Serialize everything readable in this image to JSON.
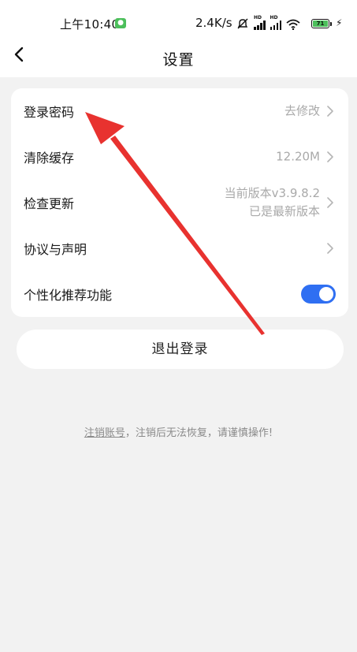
{
  "status_bar": {
    "time": "上午10:40",
    "speed": "2.4K/s",
    "battery": "71"
  },
  "header": {
    "title": "设置",
    "back_icon": "chevron-left-icon"
  },
  "settings": [
    {
      "label": "登录密码",
      "value": "去修改",
      "control": "chevron"
    },
    {
      "label": "清除缓存",
      "value": "12.20M",
      "control": "chevron"
    },
    {
      "label": "检查更新",
      "value_line1": "当前版本v3.9.8.2",
      "value_line2": "已是最新版本",
      "control": "chevron"
    },
    {
      "label": "协议与声明",
      "value": "",
      "control": "chevron"
    },
    {
      "label": "个性化推荐功能",
      "control": "toggle",
      "toggle_on": true
    }
  ],
  "logout_label": "退出登录",
  "cancel_account": {
    "link": "注销账号",
    "text": "，注销后无法恢复，请谨慎操作!"
  },
  "colors": {
    "accent": "#2f6ff2",
    "annotation_arrow": "#e8322f",
    "background": "#f2f2f2"
  }
}
